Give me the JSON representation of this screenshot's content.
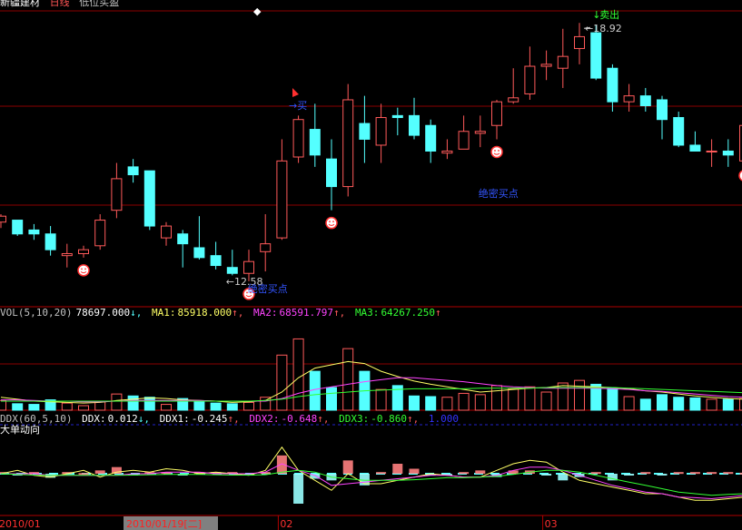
{
  "title_bar": {
    "stock_name": "新疆建材",
    "period": "日线",
    "mode": "低位买盈"
  },
  "colors": {
    "up": "#ff5a5a",
    "down": "#54ffff",
    "grid": "#8b0000",
    "ma1": "#ffff66",
    "ma2": "#ff44ff",
    "ma3": "#33ff33",
    "ddx": "#ffffff",
    "text": "#c0c0c0"
  },
  "chart_data": [
    {
      "type": "candlestick",
      "ylim": [
        11.8,
        19.3
      ],
      "candles": [
        [
          13.9,
          14.1,
          13.75,
          14.05
        ],
        [
          13.95,
          13.95,
          13.55,
          13.6
        ],
        [
          13.7,
          13.85,
          13.45,
          13.6
        ],
        [
          13.6,
          13.8,
          13.05,
          13.2
        ],
        [
          13.05,
          13.35,
          12.75,
          13.1
        ],
        [
          13.1,
          13.3,
          13.0,
          13.2
        ],
        [
          13.3,
          14.1,
          13.2,
          13.95
        ],
        [
          14.2,
          15.4,
          14.0,
          15.0
        ],
        [
          15.3,
          15.5,
          14.9,
          15.1
        ],
        [
          15.2,
          15.2,
          13.7,
          13.8
        ],
        [
          13.5,
          13.9,
          13.3,
          13.8
        ],
        [
          13.6,
          13.7,
          12.75,
          13.35
        ],
        [
          13.25,
          14.05,
          12.95,
          13.0
        ],
        [
          13.05,
          13.4,
          12.7,
          12.8
        ],
        [
          12.75,
          13.2,
          12.55,
          12.6
        ],
        [
          12.6,
          13.2,
          12.4,
          12.9
        ],
        [
          13.15,
          14.1,
          12.65,
          13.35
        ],
        [
          13.5,
          16.0,
          13.45,
          15.45
        ],
        [
          15.55,
          16.6,
          15.4,
          16.5
        ],
        [
          16.25,
          16.9,
          15.3,
          15.6
        ],
        [
          15.5,
          16.0,
          14.2,
          14.8
        ],
        [
          14.8,
          17.4,
          14.55,
          17.0
        ],
        [
          16.4,
          17.1,
          15.4,
          16.0
        ],
        [
          15.85,
          16.9,
          15.4,
          16.55
        ],
        [
          16.6,
          16.8,
          16.1,
          16.55
        ],
        [
          16.6,
          17.05,
          16.0,
          16.1
        ],
        [
          16.35,
          16.5,
          15.4,
          15.7
        ],
        [
          15.65,
          16.0,
          15.5,
          15.7
        ],
        [
          15.75,
          16.6,
          15.8,
          16.2
        ],
        [
          16.15,
          16.6,
          15.8,
          16.2
        ],
        [
          16.35,
          17.0,
          16.0,
          16.95
        ],
        [
          16.95,
          17.8,
          16.9,
          17.05
        ],
        [
          17.15,
          18.35,
          17.0,
          17.85
        ],
        [
          17.85,
          18.25,
          17.5,
          17.9
        ],
        [
          17.8,
          18.8,
          17.3,
          18.1
        ],
        [
          18.3,
          18.95,
          17.9,
          18.6
        ],
        [
          18.7,
          18.9,
          17.5,
          17.55
        ],
        [
          17.8,
          17.9,
          16.7,
          16.95
        ],
        [
          16.95,
          17.4,
          16.7,
          17.1
        ],
        [
          17.1,
          17.3,
          16.7,
          16.85
        ],
        [
          17.0,
          17.1,
          16.0,
          16.5
        ],
        [
          16.55,
          16.7,
          15.8,
          15.85
        ],
        [
          15.85,
          16.2,
          15.7,
          15.7
        ],
        [
          15.7,
          16.0,
          15.3,
          15.7
        ],
        [
          15.7,
          16.0,
          15.3,
          15.6
        ],
        [
          15.45,
          16.2,
          15.4,
          16.35
        ]
      ],
      "annotations": {
        "sell_label": "卖出",
        "high_price": "18.92",
        "low_price": "12.58",
        "buy_label": "买",
        "secret_buy_1": "绝密买点",
        "secret_buy_2": "绝密买点",
        "smiley_indices": [
          5,
          15,
          20,
          30,
          45
        ]
      }
    },
    {
      "type": "bar",
      "header": {
        "name": "VOL(5,10,20)",
        "vol": "78697.000",
        "ma1_label": "MA1:",
        "ma1": "85918.000",
        "ma2_label": "MA2:",
        "ma2": "68591.797",
        "ma3_label": "MA3:",
        "ma3": "64267.250"
      },
      "ylim": [
        0,
        140000
      ],
      "volumes": [
        15000,
        10000,
        9000,
        16000,
        11000,
        7000,
        14000,
        25000,
        22000,
        20000,
        9000,
        18000,
        13000,
        11000,
        10000,
        12000,
        20000,
        85000,
        110000,
        60000,
        35000,
        95000,
        60000,
        32000,
        38000,
        22000,
        21000,
        20000,
        26000,
        24000,
        38000,
        33000,
        36000,
        28000,
        42000,
        46000,
        40000,
        34000,
        21000,
        17000,
        24000,
        20000,
        19000,
        17000,
        17000,
        18000
      ],
      "ma1_line": [
        20000,
        17000,
        14000,
        13000,
        12000,
        11000,
        12000,
        15000,
        17000,
        19000,
        18000,
        16000,
        15000,
        14000,
        12000,
        13000,
        15000,
        28000,
        50000,
        65000,
        70000,
        75000,
        72000,
        60000,
        52000,
        45000,
        40000,
        36000,
        32000,
        28000,
        30000,
        32000,
        34000,
        35000,
        38000,
        37000,
        36000,
        35000,
        33000,
        30000,
        28000,
        25000,
        22000,
        20000,
        18000,
        17000
      ],
      "ma2_line": [
        16000,
        16000,
        15000,
        14000,
        14000,
        13000,
        13000,
        14000,
        15000,
        15000,
        15000,
        15000,
        15000,
        14000,
        14000,
        14000,
        14000,
        18000,
        26000,
        32000,
        36000,
        40000,
        44000,
        47000,
        50000,
        50000,
        48000,
        46000,
        44000,
        41000,
        38000,
        36000,
        35000,
        34000,
        34000,
        34000,
        34000,
        33000,
        32000,
        30000,
        29000,
        27000,
        25000,
        23000,
        21000,
        20000
      ],
      "ma3_line": [
        14000,
        14000,
        14000,
        14000,
        14000,
        14000,
        14000,
        14000,
        14000,
        14000,
        14000,
        14000,
        14000,
        14000,
        14000,
        14000,
        15000,
        17000,
        21000,
        24000,
        26000,
        28000,
        30000,
        31000,
        32000,
        33000,
        33000,
        33000,
        33000,
        34000,
        34000,
        34000,
        34000,
        35000,
        35000,
        35000,
        35000,
        35000,
        34000,
        33000,
        32000,
        31000,
        30000,
        29000,
        28000,
        27000
      ]
    },
    {
      "type": "line",
      "header": {
        "name": "DDX(60,5,10)",
        "ddx_label": "DDX:",
        "ddx": "0.012",
        "ddx1_label": "DDX1:",
        "ddx1": "-0.245",
        "ddx2_label": "DDX2:",
        "ddx2": "-0.648",
        "ddx3_label": "DDX3:",
        "ddx3": "-0.860",
        "ref": "1.000"
      },
      "subtitle": "大单动向",
      "ylim": [
        -1.2,
        1.2
      ],
      "ddx_bars": [
        0.05,
        -0.05,
        0.05,
        -0.12,
        0.05,
        0.02,
        0.1,
        0.2,
        -0.05,
        0.05,
        0.05,
        -0.05,
        0.05,
        0.05,
        0.05,
        -0.05,
        0.05,
        0.55,
        -0.9,
        -0.15,
        -0.2,
        0.4,
        -0.35,
        0.05,
        0.3,
        0.15,
        -0.05,
        -0.05,
        0.05,
        0.1,
        -0.1,
        0.1,
        0.1,
        -0.05,
        -0.2,
        -0.1,
        0.05,
        -0.2,
        -0.05,
        0.05,
        -0.05,
        0.05,
        0.05,
        0.05,
        0.05,
        0.03
      ],
      "ddx1_line": [
        0.0,
        0.1,
        -0.05,
        -0.1,
        0.0,
        0.1,
        -0.1,
        0.05,
        0.1,
        0.05,
        0.15,
        0.1,
        0.0,
        0.05,
        0.0,
        -0.05,
        0.1,
        0.8,
        0.1,
        -0.2,
        -0.5,
        0.0,
        -0.3,
        -0.3,
        -0.2,
        -0.1,
        0.0,
        -0.05,
        -0.1,
        -0.1,
        0.1,
        0.3,
        0.4,
        0.35,
        0.05,
        -0.2,
        -0.3,
        -0.4,
        -0.5,
        -0.6,
        -0.6,
        -0.7,
        -0.8,
        -0.8,
        -0.75,
        -0.7
      ],
      "ddx2_line": [
        0.0,
        0.0,
        0.0,
        -0.05,
        -0.05,
        -0.05,
        -0.05,
        -0.05,
        0.0,
        0.0,
        0.05,
        0.05,
        0.05,
        0.0,
        0.0,
        0.0,
        0.05,
        0.3,
        0.1,
        -0.05,
        -0.35,
        -0.3,
        -0.25,
        -0.2,
        -0.15,
        -0.1,
        -0.05,
        -0.05,
        -0.1,
        -0.1,
        -0.05,
        0.1,
        0.2,
        0.2,
        0.1,
        -0.05,
        -0.2,
        -0.35,
        -0.45,
        -0.55,
        -0.6,
        -0.7,
        -0.72,
        -0.75,
        -0.7,
        -0.65
      ],
      "ddx3_line": [
        0.0,
        -0.02,
        -0.04,
        -0.05,
        -0.05,
        -0.05,
        -0.05,
        -0.05,
        -0.04,
        -0.03,
        -0.02,
        -0.02,
        -0.02,
        -0.03,
        -0.04,
        -0.04,
        -0.03,
        0.05,
        0.1,
        0.05,
        -0.1,
        -0.15,
        -0.2,
        -0.2,
        -0.2,
        -0.18,
        -0.15,
        -0.12,
        -0.12,
        -0.1,
        -0.08,
        -0.02,
        0.05,
        0.1,
        0.1,
        0.05,
        -0.05,
        -0.15,
        -0.25,
        -0.35,
        -0.45,
        -0.55,
        -0.6,
        -0.65,
        -0.62,
        -0.6
      ]
    }
  ],
  "x_axis": {
    "labels": [
      "2010/01",
      "02",
      "03"
    ],
    "label_indices": [
      0,
      17,
      33
    ],
    "cursor_date": "2010/01/19[二]",
    "cursor_index": 9
  }
}
